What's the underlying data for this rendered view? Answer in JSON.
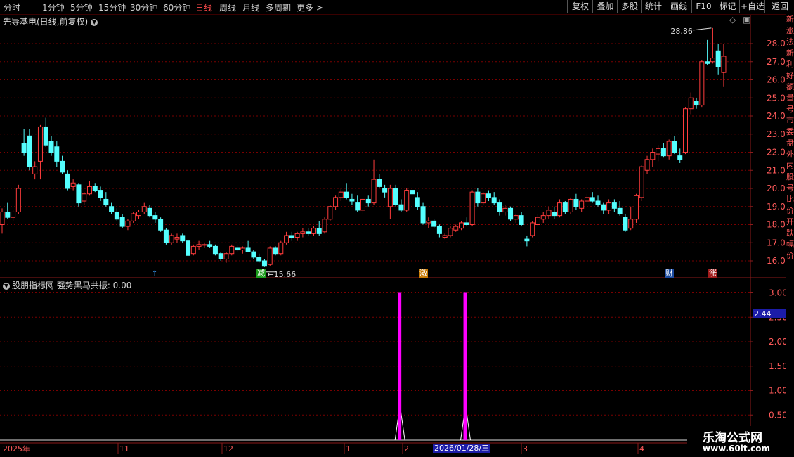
{
  "toolbar": {
    "periods": [
      "分时",
      "1分钟",
      "5分钟",
      "15分钟",
      "30分钟",
      "60分钟",
      "日线",
      "周线",
      "月线",
      "多周期",
      "更多"
    ],
    "active_period": "日线",
    "right_buttons": [
      "复权",
      "叠加",
      "多股",
      "统计",
      "画线",
      "F10",
      "标记",
      "+自选",
      "返回"
    ]
  },
  "main_pane": {
    "title": "先导基电(日线,前复权)",
    "high_label": "28.86",
    "low_label": "15.66",
    "y_ticks": [
      "28.00",
      "27.00",
      "26.00",
      "25.00",
      "24.00",
      "23.00",
      "22.00",
      "21.00",
      "20.00",
      "19.00",
      "18.00",
      "17.00",
      "16.00"
    ],
    "signal_tags": [
      {
        "text": "减",
        "color": "#1a9a1a"
      },
      {
        "text": "激",
        "color": "#c87800"
      },
      {
        "text": "财",
        "color": "#1a4aa0"
      },
      {
        "text": "涨",
        "color": "#a01a1a"
      }
    ]
  },
  "indicator_pane": {
    "title": "股朋指标网  强势黑马共振: 0.00",
    "current_value": "2.44",
    "y_ticks": [
      "3.00",
      "2.50",
      "2.00",
      "1.50",
      "1.00",
      "0.50"
    ]
  },
  "x_axis": {
    "labels": [
      "2025年",
      "11",
      "12",
      "1",
      "2",
      "3",
      "4"
    ],
    "cursor_date": "2026/01/28/三"
  },
  "right_strip_chars": [
    "新",
    "涨",
    "法",
    "新",
    "利",
    "好",
    "额",
    "量",
    "号",
    "市",
    "委",
    "盘",
    "外",
    "内",
    "股",
    "号",
    "比",
    "价",
    "开",
    "跌",
    "幅",
    "价"
  ],
  "logo": {
    "line1": "乐淘公式网",
    "line2": "www.60lt.com"
  },
  "colors": {
    "up": "#ff3c3c",
    "down": "#54ffff",
    "grid": "#7a0000",
    "axis": "#8b1a1a",
    "signal": "#ff00ff"
  },
  "chart_data": {
    "type": "candlestick",
    "title": "先导基电(日线,前复权)",
    "ylim": [
      15.5,
      29.0
    ],
    "ohlc": [
      [
        18.0,
        18.9,
        17.5,
        18.7
      ],
      [
        18.7,
        19.2,
        18.3,
        18.4
      ],
      [
        18.4,
        18.8,
        18.2,
        18.7
      ],
      [
        18.7,
        20.2,
        18.6,
        20.0
      ],
      [
        22.5,
        23.3,
        21.8,
        22.0
      ],
      [
        22.9,
        23.3,
        21.0,
        21.2
      ],
      [
        20.8,
        21.5,
        20.5,
        21.2
      ],
      [
        21.5,
        23.5,
        20.5,
        23.4
      ],
      [
        23.4,
        23.9,
        22.3,
        22.4
      ],
      [
        22.6,
        22.9,
        21.8,
        22.0
      ],
      [
        22.3,
        22.6,
        21.2,
        21.5
      ],
      [
        21.5,
        21.8,
        20.8,
        20.9
      ],
      [
        20.8,
        21.0,
        19.9,
        20.0
      ],
      [
        20.1,
        20.5,
        19.9,
        20.3
      ],
      [
        20.2,
        20.3,
        19.0,
        19.2
      ],
      [
        19.3,
        19.8,
        19.1,
        19.7
      ],
      [
        19.7,
        20.4,
        19.6,
        20.1
      ],
      [
        20.1,
        20.3,
        19.8,
        19.9
      ],
      [
        19.9,
        20.1,
        19.3,
        19.5
      ],
      [
        19.4,
        19.8,
        19.0,
        19.1
      ],
      [
        19.0,
        19.2,
        18.6,
        18.7
      ],
      [
        18.7,
        18.9,
        18.2,
        18.3
      ],
      [
        18.4,
        18.6,
        17.8,
        17.9
      ],
      [
        17.9,
        18.3,
        17.7,
        18.2
      ],
      [
        18.2,
        18.7,
        18.1,
        18.6
      ],
      [
        18.5,
        18.8,
        18.3,
        18.7
      ],
      [
        18.7,
        19.2,
        18.6,
        19.0
      ],
      [
        18.9,
        19.1,
        18.4,
        18.5
      ],
      [
        18.5,
        18.7,
        18.1,
        18.3
      ],
      [
        18.3,
        18.4,
        17.6,
        17.7
      ],
      [
        17.7,
        17.8,
        16.9,
        17.0
      ],
      [
        17.0,
        17.5,
        16.9,
        17.4
      ],
      [
        17.2,
        17.5,
        17.0,
        17.3
      ],
      [
        17.4,
        17.5,
        17.0,
        17.1
      ],
      [
        17.1,
        17.2,
        16.2,
        16.3
      ],
      [
        16.4,
        16.9,
        16.3,
        16.8
      ],
      [
        16.8,
        17.1,
        16.6,
        16.9
      ],
      [
        16.9,
        17.0,
        16.7,
        16.9
      ],
      [
        16.9,
        17.1,
        16.7,
        16.8
      ],
      [
        16.8,
        16.9,
        16.3,
        16.4
      ],
      [
        16.4,
        16.5,
        16.0,
        16.1
      ],
      [
        16.1,
        16.5,
        15.9,
        16.4
      ],
      [
        16.4,
        16.9,
        16.3,
        16.8
      ],
      [
        16.7,
        16.9,
        16.5,
        16.6
      ],
      [
        16.6,
        16.8,
        16.4,
        16.7
      ],
      [
        16.7,
        17.1,
        16.5,
        16.5
      ],
      [
        16.5,
        16.6,
        16.1,
        16.2
      ],
      [
        16.2,
        16.4,
        15.9,
        16.0
      ],
      [
        16.0,
        16.1,
        15.66,
        15.7
      ],
      [
        15.8,
        16.8,
        15.7,
        16.7
      ],
      [
        16.7,
        16.8,
        16.3,
        16.4
      ],
      [
        16.4,
        17.1,
        16.3,
        17.0
      ],
      [
        17.0,
        17.6,
        16.9,
        17.4
      ],
      [
        17.4,
        17.6,
        17.1,
        17.3
      ],
      [
        17.3,
        17.6,
        17.1,
        17.5
      ],
      [
        17.5,
        17.8,
        17.3,
        17.6
      ],
      [
        17.6,
        17.8,
        17.4,
        17.5
      ],
      [
        17.5,
        17.9,
        17.4,
        17.8
      ],
      [
        17.8,
        18.2,
        17.4,
        17.5
      ],
      [
        17.6,
        18.4,
        17.5,
        18.3
      ],
      [
        18.3,
        19.1,
        18.2,
        19.0
      ],
      [
        19.0,
        19.6,
        18.8,
        19.5
      ],
      [
        19.5,
        20.0,
        19.3,
        19.8
      ],
      [
        19.8,
        20.3,
        19.4,
        19.5
      ],
      [
        19.4,
        19.7,
        19.1,
        19.3
      ],
      [
        19.2,
        19.6,
        18.7,
        18.8
      ],
      [
        18.8,
        19.5,
        18.6,
        19.4
      ],
      [
        19.4,
        19.6,
        19.0,
        19.2
      ],
      [
        19.2,
        21.6,
        19.1,
        20.5
      ],
      [
        20.5,
        20.8,
        20.0,
        20.1
      ],
      [
        20.0,
        20.2,
        19.5,
        19.8
      ],
      [
        19.0,
        20.2,
        18.3,
        20.0
      ],
      [
        20.0,
        20.2,
        19.0,
        19.1
      ],
      [
        19.1,
        19.4,
        18.7,
        18.8
      ],
      [
        18.8,
        20.0,
        18.7,
        19.9
      ],
      [
        19.9,
        20.1,
        19.6,
        19.7
      ],
      [
        19.5,
        19.8,
        18.8,
        19.0
      ],
      [
        19.0,
        19.2,
        18.0,
        18.1
      ],
      [
        18.1,
        18.4,
        17.8,
        18.2
      ],
      [
        18.2,
        18.3,
        17.8,
        17.9
      ],
      [
        17.9,
        18.0,
        17.3,
        17.5
      ],
      [
        17.3,
        17.5,
        17.2,
        17.4
      ],
      [
        17.4,
        17.9,
        17.3,
        17.8
      ],
      [
        17.7,
        18.0,
        17.6,
        17.9
      ],
      [
        17.8,
        18.2,
        17.7,
        18.1
      ],
      [
        18.1,
        18.4,
        17.9,
        18.0
      ],
      [
        18.0,
        19.9,
        17.9,
        19.8
      ],
      [
        19.8,
        20.0,
        19.0,
        19.2
      ],
      [
        19.2,
        19.8,
        19.1,
        19.7
      ],
      [
        19.7,
        19.9,
        19.3,
        19.5
      ],
      [
        19.5,
        19.8,
        19.1,
        19.2
      ],
      [
        19.2,
        19.4,
        18.5,
        18.7
      ],
      [
        18.7,
        19.1,
        18.5,
        18.9
      ],
      [
        18.9,
        19.0,
        18.2,
        18.3
      ],
      [
        18.3,
        18.6,
        18.1,
        18.5
      ],
      [
        18.5,
        18.7,
        17.9,
        18.0
      ],
      [
        17.2,
        17.4,
        16.8,
        17.1
      ],
      [
        17.4,
        18.2,
        17.3,
        18.1
      ],
      [
        18.0,
        18.6,
        17.9,
        18.4
      ],
      [
        18.3,
        18.7,
        18.1,
        18.5
      ],
      [
        18.5,
        19.0,
        18.3,
        18.8
      ],
      [
        18.7,
        19.0,
        18.3,
        18.5
      ],
      [
        18.5,
        19.4,
        18.4,
        19.2
      ],
      [
        19.2,
        19.3,
        18.6,
        18.7
      ],
      [
        18.7,
        19.5,
        18.6,
        19.4
      ],
      [
        19.4,
        19.7,
        18.8,
        19.0
      ],
      [
        18.9,
        19.4,
        18.7,
        19.3
      ],
      [
        19.3,
        19.7,
        19.2,
        19.5
      ],
      [
        19.5,
        19.8,
        19.2,
        19.3
      ],
      [
        19.3,
        19.6,
        19.0,
        19.1
      ],
      [
        19.1,
        19.2,
        18.6,
        18.8
      ],
      [
        18.8,
        19.4,
        18.6,
        19.2
      ],
      [
        19.2,
        19.4,
        18.7,
        18.9
      ],
      [
        18.9,
        19.3,
        18.5,
        18.6
      ],
      [
        18.4,
        18.6,
        17.6,
        17.7
      ],
      [
        17.8,
        19.0,
        17.7,
        18.3
      ],
      [
        18.3,
        19.7,
        18.1,
        19.6
      ],
      [
        19.5,
        21.3,
        19.3,
        21.2
      ],
      [
        21.0,
        21.8,
        20.8,
        21.6
      ],
      [
        21.6,
        22.2,
        21.2,
        22.0
      ],
      [
        21.9,
        22.4,
        21.5,
        22.2
      ],
      [
        22.2,
        22.5,
        21.7,
        21.8
      ],
      [
        21.8,
        22.7,
        21.6,
        22.6
      ],
      [
        22.6,
        22.9,
        21.9,
        22.0
      ],
      [
        21.8,
        22.2,
        21.4,
        21.6
      ],
      [
        22.0,
        24.5,
        21.9,
        24.4
      ],
      [
        24.4,
        25.3,
        24.1,
        25.0
      ],
      [
        24.8,
        25.0,
        24.4,
        24.6
      ],
      [
        24.6,
        27.1,
        24.5,
        27.0
      ],
      [
        27.0,
        28.2,
        26.8,
        26.9
      ],
      [
        27.0,
        28.86,
        26.9,
        27.2
      ],
      [
        27.6,
        28.0,
        26.3,
        26.7
      ],
      [
        26.4,
        28.0,
        25.6,
        27.3
      ]
    ],
    "indicator": {
      "name": "强势黑马共振",
      "signal_bars": [
        {
          "index": 72,
          "value": 3.0
        },
        {
          "index": 84,
          "value": 3.0
        }
      ]
    }
  }
}
